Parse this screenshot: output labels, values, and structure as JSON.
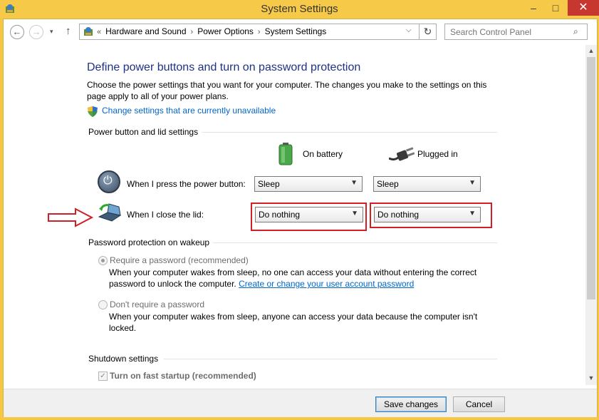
{
  "window": {
    "title": "System Settings",
    "minimize_label": "–",
    "maximize_label": "□",
    "close_label": "✕"
  },
  "nav": {
    "back": "←",
    "forward": "→",
    "recent": "▾",
    "up": "↑",
    "breadcrumb_prefix": "«",
    "breadcrumbs": [
      "Hardware and Sound",
      "Power Options",
      "System Settings"
    ],
    "breadcrumb_sep": "›",
    "dropdown": "⌵",
    "refresh": "↻",
    "search_placeholder": "Search Control Panel",
    "search_icon": "⌕"
  },
  "main": {
    "heading": "Define power buttons and turn on password protection",
    "intro": "Choose the power settings that you want for your computer. The changes you make to the settings on this page apply to all of your power plans.",
    "change_link": "Change settings that are currently unavailable"
  },
  "power_section": {
    "title": "Power button and lid settings",
    "col_battery": "On battery",
    "col_plugged": "Plugged in",
    "power_button_label": "When I press the power button:",
    "lid_label": "When I close the lid:",
    "power_battery": "Sleep",
    "power_plugged": "Sleep",
    "lid_battery": "Do nothing",
    "lid_plugged": "Do nothing",
    "select_arrow": "▼",
    "power_glyph": "⏻"
  },
  "password_section": {
    "title": "Password protection on wakeup",
    "require_label": "Require a password (recommended)",
    "require_desc": "When your computer wakes from sleep, no one can access your data without entering the correct password to unlock the computer.",
    "account_link": "Create or change your user account password",
    "norequire_label": "Don't require a password",
    "norequire_desc": "When your computer wakes from sleep, anyone can access your data because the computer isn't locked.",
    "selected": "require"
  },
  "shutdown_section": {
    "title": "Shutdown settings",
    "fast_startup_label": "Turn on fast startup (recommended)",
    "fast_startup_checked": true,
    "check_glyph": "✓"
  },
  "scroll": {
    "up": "▲",
    "down": "▼"
  },
  "footer": {
    "save_label": "Save changes",
    "cancel_label": "Cancel"
  },
  "colors": {
    "titlebar": "#f7c948",
    "heading": "#1e3287",
    "link": "#0066cc",
    "annotation_red": "#d01f26"
  }
}
